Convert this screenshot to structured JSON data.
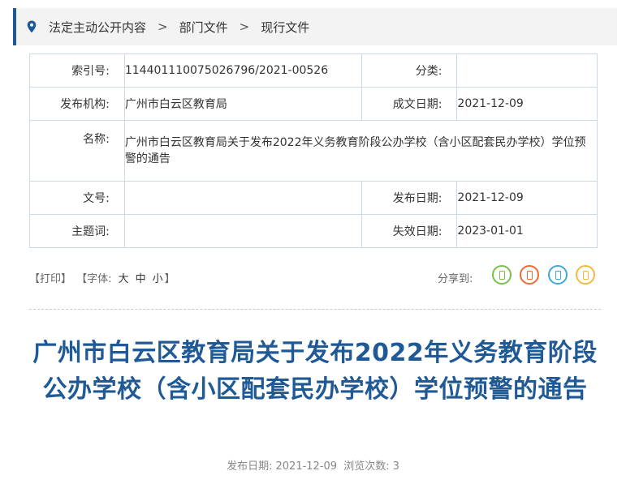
{
  "breadcrumb": {
    "items": [
      "法定主动公开内容",
      "部门文件",
      "现行文件"
    ],
    "separator": ">"
  },
  "meta": {
    "index_label": "索引号:",
    "index_value": "11440111007502679 6/2021-00526",
    "category_label": "分类:",
    "category_value": "",
    "publisher_label": "发布机构:",
    "publisher_value": "广州市白云区教育局",
    "doc_date_label": "成文日期:",
    "doc_date_value": "2021-12-09",
    "name_label": "名称:",
    "name_value": "广州市白云区教育局关于发布2022年义务教育阶段公办学校（含小区配套民办学校）学位预警的通告",
    "doc_no_label": "文号:",
    "doc_no_value": "",
    "pub_date_label": "发布日期:",
    "pub_date_value": "2021-12-09",
    "keywords_label": "主题词:",
    "keywords_value": "",
    "expire_label": "失效日期:",
    "expire_value": "2023-01-01"
  },
  "tools": {
    "print": "【打印】",
    "font_prefix": "【字体:",
    "font_large": "大",
    "font_medium": "中",
    "font_small": "小",
    "font_suffix": "】",
    "share_label": "分享到:",
    "share_icons": [
      {
        "name": "wechat-icon",
        "color": "#79c04a"
      },
      {
        "name": "weibo-icon",
        "color": "#f06a35"
      },
      {
        "name": "qq-icon",
        "color": "#41a6d8"
      },
      {
        "name": "qzone-icon",
        "color": "#f5b942"
      }
    ]
  },
  "article": {
    "title": "广州市白云区教育局关于发布2022年义务教育阶段公办学校（含小区配套民办学校）学位预警的通告",
    "pub_date_label": "发布日期:",
    "pub_date_value": "2021-12-09",
    "views_label": "浏览次数:",
    "views_value": "3"
  }
}
